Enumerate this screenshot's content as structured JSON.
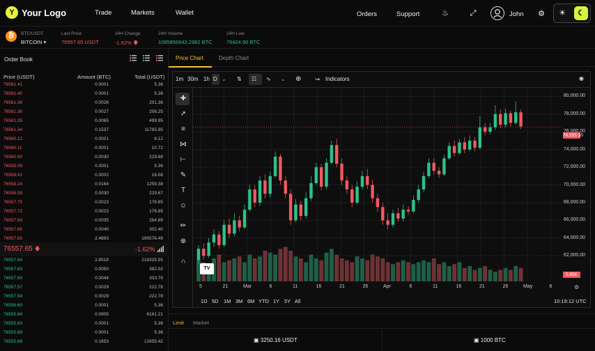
{
  "header": {
    "logo": "Your Logo",
    "logo_mark": "Y",
    "nav": [
      "Trade",
      "Markets",
      "Wallet"
    ],
    "right_nav": [
      "Orders",
      "Support"
    ],
    "user": "John"
  },
  "ticker": {
    "pair": "BTC/USDT",
    "coin": "BITCOIN",
    "last_label": "Last Price",
    "last_value": "76557.65 USDT",
    "change_label": "24H Change",
    "change_value": "-1.62%",
    "volume_label": "24H Volume",
    "volume_value": "1085856643.2982 BTC",
    "low_label": "24H Low",
    "low_value": "76424.90 BTC"
  },
  "orderbook": {
    "title": "Order Book",
    "col_price": "Price (USDT)",
    "col_amount": "Amount (BTC)",
    "col_total": "Total (USDT)",
    "asks": [
      [
        "76561.41",
        "0.0001",
        "5.36"
      ],
      [
        "76561.40",
        "0.0001",
        "5.36"
      ],
      [
        "76561.38",
        "0.0026",
        "201.36"
      ],
      [
        "76561.36",
        "0.0027",
        "208.25"
      ],
      [
        "76561.35",
        "0.0065",
        "499.95"
      ],
      [
        "76561.34",
        "0.1537",
        "11765.95"
      ],
      [
        "76560.12",
        "0.0001",
        "6.12"
      ],
      [
        "76560.11",
        "0.0001",
        "10.72"
      ],
      [
        "76560.00",
        "0.0030",
        "229.68"
      ],
      [
        "76559.09",
        "0.0001",
        "5.36"
      ],
      [
        "76558.91",
        "0.0002",
        "16.08"
      ],
      [
        "76558.24",
        "0.0164",
        "1259.38"
      ],
      [
        "76558.08",
        "0.0030",
        "229.67"
      ],
      [
        "76557.75",
        "0.0023",
        "176.85"
      ],
      [
        "76557.72",
        "0.0023",
        "176.85"
      ],
      [
        "76557.69",
        "0.0035",
        "264.89"
      ],
      [
        "76557.66",
        "0.0040",
        "302.40"
      ],
      [
        "76557.65",
        "2.4893",
        "190576.49"
      ]
    ],
    "mid_price": "76557.65",
    "mid_change": "-1.62%",
    "bids": [
      [
        "76557.64",
        "2.8518",
        "218325.55"
      ],
      [
        "76557.63",
        "0.0050",
        "382.02"
      ],
      [
        "76557.60",
        "0.0044",
        "333.79"
      ],
      [
        "76557.57",
        "0.0029",
        "222.78"
      ],
      [
        "76557.54",
        "0.0029",
        "222.78"
      ],
      [
        "76556.60",
        "0.0001",
        "5.36"
      ],
      [
        "76555.84",
        "0.0805",
        "6161.21"
      ],
      [
        "76555.83",
        "0.0001",
        "5.36"
      ],
      [
        "76555.69",
        "0.0001",
        "5.36"
      ],
      [
        "76555.68",
        "0.1653",
        "12655.42"
      ]
    ]
  },
  "chart_tabs": [
    "Price Chart",
    "Depth Chart"
  ],
  "toolbar": {
    "intervals": [
      "1m",
      "30m",
      "1h",
      "D"
    ],
    "indicators": "Indicators"
  },
  "ranges": [
    "1D",
    "5D",
    "1M",
    "3M",
    "6M",
    "YTD",
    "1Y",
    "5Y",
    "All"
  ],
  "clock": "10:19:12 UTC",
  "price_tag": "76,555.10",
  "volume_tag": "5.85K",
  "bottom": {
    "tabs": [
      "Limit",
      "Market"
    ],
    "balance_usdt": "3250.16 USDT",
    "balance_btc": "1000 BTC"
  },
  "colors": {
    "up": "#2fc089",
    "down": "#ee5a60",
    "accent": "#f2c230",
    "brand": "#e6f23c"
  },
  "chart_data": {
    "type": "candlestick",
    "yticks": [
      "80,000.00",
      "78,000.00",
      "76,000.00",
      "74,000.00",
      "72,000.00",
      "70,000.00",
      "68,000.00",
      "66,000.00",
      "64,000.00",
      "62,000.00"
    ],
    "xticks": [
      "5",
      "21",
      "Mar",
      "6",
      "11",
      "16",
      "21",
      "26",
      "Apr",
      "6",
      "11",
      "16",
      "21",
      "26",
      "May",
      "6"
    ],
    "ylim": [
      61000,
      80500
    ],
    "candles": [
      [
        61500,
        62800,
        61000,
        63200
      ],
      [
        62800,
        62000,
        61600,
        63400
      ],
      [
        62000,
        63500,
        61800,
        64000
      ],
      [
        63500,
        64400,
        63000,
        65000
      ],
      [
        64400,
        63200,
        62800,
        64800
      ],
      [
        63200,
        65500,
        63000,
        66000
      ],
      [
        65500,
        64500,
        64000,
        66200
      ],
      [
        64500,
        66000,
        64200,
        66800
      ],
      [
        66000,
        65200,
        64800,
        66500
      ],
      [
        65200,
        67200,
        65000,
        67800
      ],
      [
        67200,
        69500,
        67000,
        70000
      ],
      [
        69500,
        68000,
        67500,
        70000
      ],
      [
        68000,
        70500,
        67600,
        71000
      ],
      [
        70500,
        69000,
        68500,
        71200
      ],
      [
        69000,
        71000,
        68600,
        71500
      ],
      [
        71000,
        73200,
        70800,
        73800
      ],
      [
        73200,
        70500,
        70000,
        73500
      ],
      [
        70500,
        69000,
        68500,
        71000
      ],
      [
        69000,
        66000,
        65500,
        69500
      ],
      [
        66000,
        67800,
        65800,
        68400
      ],
      [
        67800,
        66500,
        66000,
        68200
      ],
      [
        66500,
        68500,
        66200,
        69200
      ],
      [
        68500,
        70200,
        68200,
        71000
      ],
      [
        70200,
        72000,
        70000,
        72500
      ],
      [
        72000,
        69800,
        69400,
        72400
      ],
      [
        69800,
        72500,
        69500,
        73000
      ],
      [
        72500,
        74500,
        72300,
        75000
      ],
      [
        74500,
        72400,
        72000,
        75200
      ],
      [
        72400,
        70500,
        70000,
        73000
      ],
      [
        70500,
        69500,
        69000,
        71000
      ],
      [
        69500,
        68000,
        67500,
        70000
      ],
      [
        68000,
        69800,
        67800,
        70400
      ],
      [
        69800,
        71000,
        69500,
        71600
      ],
      [
        71000,
        70000,
        69500,
        71800
      ],
      [
        70000,
        68500,
        68000,
        70600
      ],
      [
        68500,
        67500,
        67000,
        69000
      ],
      [
        67500,
        66000,
        65500,
        68000
      ],
      [
        66000,
        65500,
        65000,
        66800
      ],
      [
        65500,
        66800,
        65200,
        67200
      ],
      [
        66800,
        66200,
        65800,
        67400
      ],
      [
        66200,
        67200,
        65900,
        67800
      ],
      [
        67200,
        67000,
        66600,
        67600
      ],
      [
        67000,
        68300,
        66800,
        68800
      ],
      [
        68300,
        69500,
        68000,
        70000
      ],
      [
        69500,
        71000,
        69200,
        71500
      ],
      [
        71000,
        72500,
        70800,
        73000
      ],
      [
        72500,
        71600,
        71200,
        73000
      ],
      [
        71600,
        71200,
        70800,
        72000
      ],
      [
        71200,
        73000,
        71000,
        73400
      ],
      [
        73000,
        74400,
        72800,
        74800
      ],
      [
        74400,
        73600,
        73200,
        75000
      ],
      [
        73600,
        74800,
        73400,
        75200
      ],
      [
        74800,
        74000,
        73600,
        75400
      ],
      [
        74000,
        75000,
        73800,
        75600
      ],
      [
        75000,
        74200,
        73800,
        75400
      ],
      [
        74200,
        76500,
        74000,
        77800
      ],
      [
        76500,
        76000,
        75600,
        77000
      ],
      [
        76000,
        76500,
        75700,
        77000
      ],
      [
        76500,
        78000,
        76200,
        79000
      ],
      [
        78000,
        76800,
        76400,
        78500
      ],
      [
        76800,
        78100,
        76500,
        78600
      ],
      [
        78100,
        77000,
        76600,
        78400
      ],
      [
        77000,
        78200,
        76800,
        79400
      ],
      [
        78200,
        76600,
        76300,
        78500
      ]
    ],
    "volumes": [
      0.55,
      0.5,
      0.45,
      0.6,
      0.7,
      0.5,
      0.55,
      0.6,
      0.65,
      0.5,
      0.7,
      0.6,
      0.65,
      0.8,
      0.75,
      0.7,
      0.85,
      0.9,
      0.8,
      0.65,
      0.6,
      0.5,
      0.7,
      0.6,
      0.55,
      0.75,
      0.85,
      0.7,
      0.6,
      0.55,
      0.5,
      0.65,
      0.6,
      0.55,
      0.7,
      0.65,
      0.6,
      0.5,
      0.45,
      0.5,
      0.55,
      0.5,
      0.45,
      0.5,
      0.55,
      0.5,
      0.6,
      0.45,
      0.5,
      0.4,
      0.45,
      0.5,
      0.35,
      0.4,
      0.3,
      0.35,
      0.4,
      0.3,
      0.25,
      0.3,
      0.35,
      0.3,
      0.4,
      0.35
    ]
  }
}
